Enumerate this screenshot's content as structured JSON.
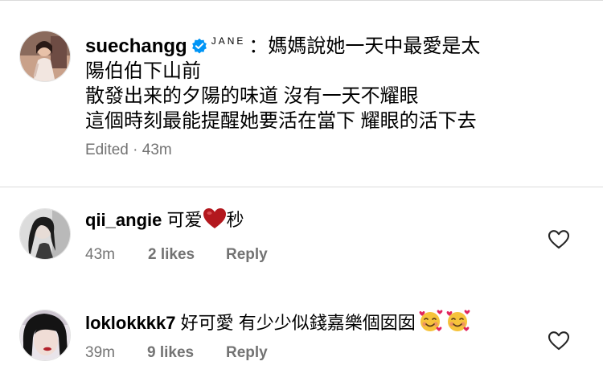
{
  "post": {
    "username": "suechangg",
    "tagged_name": "JANE",
    "caption_lines": [
      "：媽媽說她一天中最愛是太",
      "陽伯伯下山前",
      "散發出来的夕陽的味道 沒有一天不耀眼",
      "這個時刻最能提醒她要活在當下 耀眼的活下去"
    ],
    "edited_label": "Edited",
    "time": "43m"
  },
  "comments": [
    {
      "username": "qii_angie",
      "text_before": "可爱",
      "text_after": "秒",
      "time": "43m",
      "likes": "2 likes",
      "reply": "Reply"
    },
    {
      "username": "loklokkkk7",
      "text": "好可愛 有少少似錢嘉樂個囡囡",
      "time": "39m",
      "likes": "9 likes",
      "reply": "Reply"
    }
  ],
  "icons": {
    "verified": "verified-badge-icon",
    "heart_outline": "heart-outline-icon",
    "red_heart": "red-heart-emoji",
    "smiling_hearts": "smiling-face-with-hearts-emoji"
  },
  "colors": {
    "verified": "#0095f6",
    "meta": "#737373",
    "divider": "#dbdbdb",
    "red_heart": "#b3181e"
  }
}
